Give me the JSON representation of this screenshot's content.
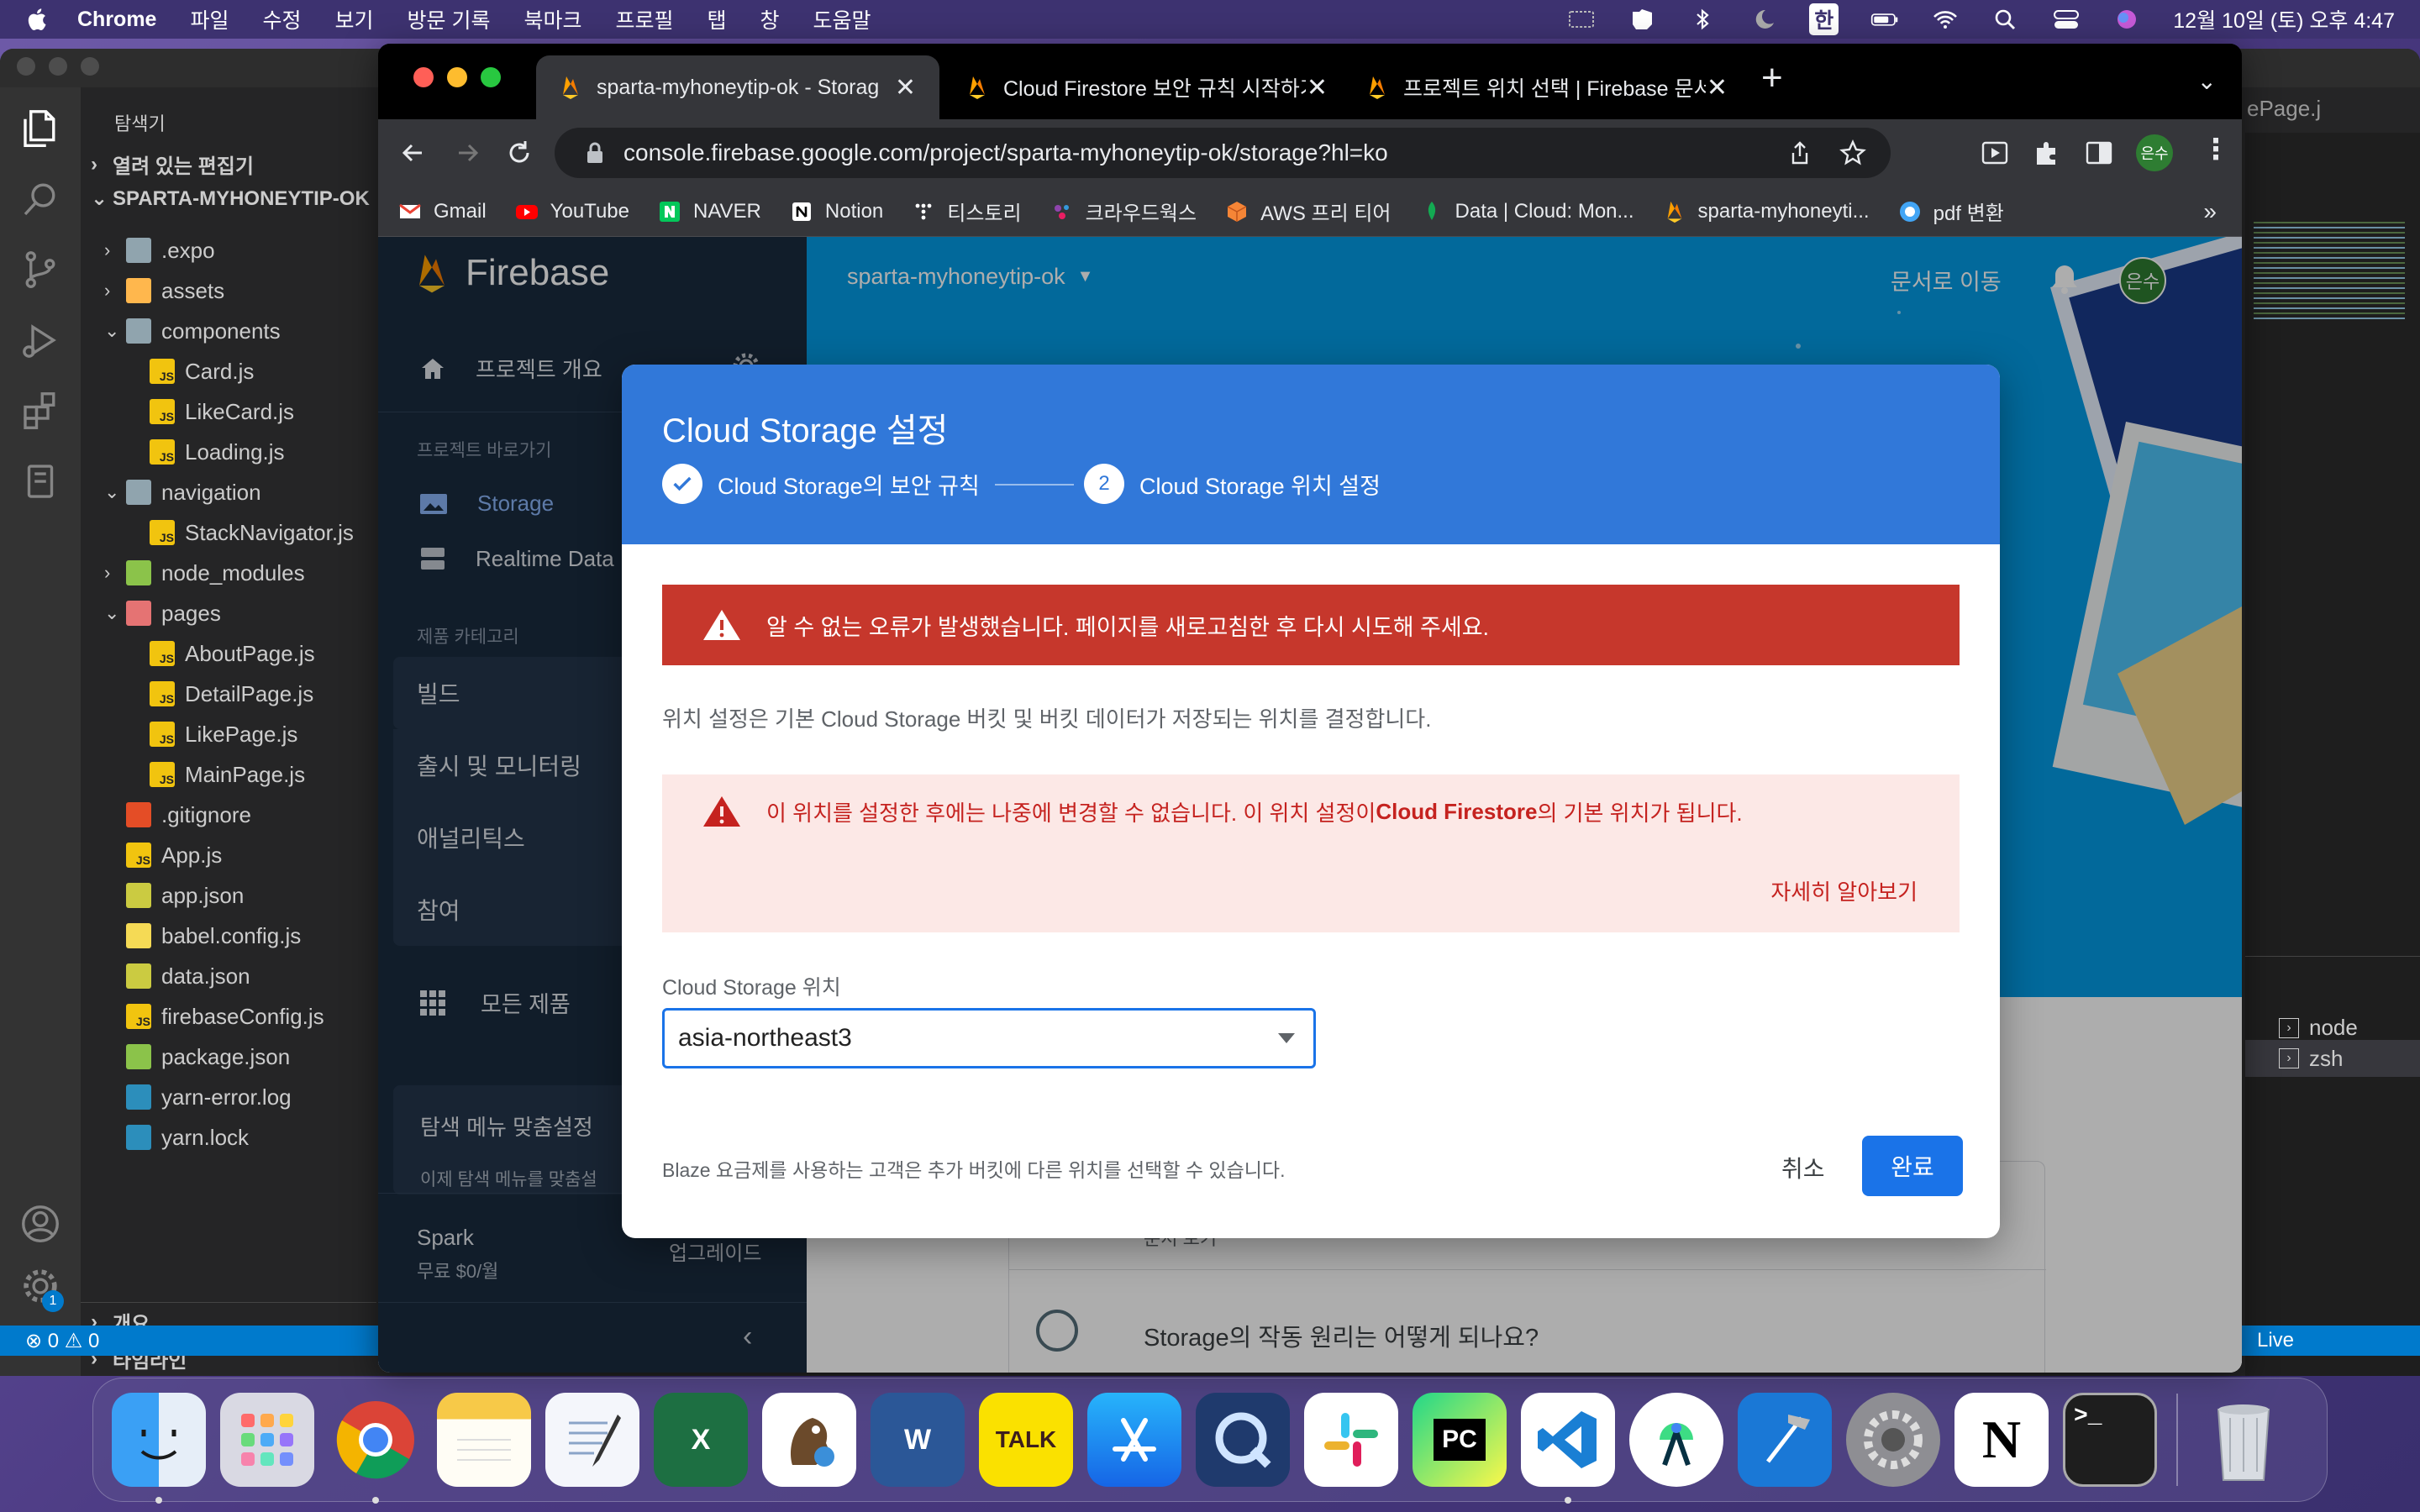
{
  "menubar": {
    "app": "Chrome",
    "items": [
      "파일",
      "수정",
      "보기",
      "방문 기록",
      "북마크",
      "프로필",
      "탭",
      "창",
      "도움말"
    ],
    "ime": "한",
    "datetime": "12월 10일 (토) 오후 4:47"
  },
  "vscode": {
    "explorer_title": "탐색기",
    "open_editors": "열려 있는 편집기",
    "project": "SPARTA-MYHONEYTIP-OK",
    "tree": [
      {
        "name": ".expo",
        "type": "folder",
        "depth": 1,
        "open": false
      },
      {
        "name": "assets",
        "type": "folder",
        "depth": 1,
        "open": false
      },
      {
        "name": "components",
        "type": "folder",
        "depth": 1,
        "open": true
      },
      {
        "name": "Card.js",
        "type": "js",
        "depth": 2
      },
      {
        "name": "LikeCard.js",
        "type": "js",
        "depth": 2
      },
      {
        "name": "Loading.js",
        "type": "js",
        "depth": 2
      },
      {
        "name": "navigation",
        "type": "folder",
        "depth": 1,
        "open": true
      },
      {
        "name": "StackNavigator.js",
        "type": "js",
        "depth": 2
      },
      {
        "name": "node_modules",
        "type": "folder",
        "depth": 1,
        "open": false
      },
      {
        "name": "pages",
        "type": "folder",
        "depth": 1,
        "open": true
      },
      {
        "name": "AboutPage.js",
        "type": "js",
        "depth": 2
      },
      {
        "name": "DetailPage.js",
        "type": "js",
        "depth": 2
      },
      {
        "name": "LikePage.js",
        "type": "js",
        "depth": 2
      },
      {
        "name": "MainPage.js",
        "type": "js",
        "depth": 2
      },
      {
        "name": ".gitignore",
        "type": "git",
        "depth": 1
      },
      {
        "name": "App.js",
        "type": "js",
        "depth": 1
      },
      {
        "name": "app.json",
        "type": "json",
        "depth": 1
      },
      {
        "name": "babel.config.js",
        "type": "babel",
        "depth": 1
      },
      {
        "name": "data.json",
        "type": "json",
        "depth": 1
      },
      {
        "name": "firebaseConfig.js",
        "type": "js",
        "depth": 1
      },
      {
        "name": "package.json",
        "type": "pkg",
        "depth": 1
      },
      {
        "name": "yarn-error.log",
        "type": "yarn",
        "depth": 1
      },
      {
        "name": "yarn.lock",
        "type": "yarn",
        "depth": 1
      }
    ],
    "outline": "개요",
    "timeline": "타임라인",
    "status_left": "⊗ 0 ⚠ 0",
    "status_right": "Live",
    "editor_tab_fragment": "ePage.j",
    "terminals": [
      "node",
      "zsh"
    ],
    "settings_badge": "1"
  },
  "chrome": {
    "tabs": [
      {
        "title": "sparta-myhoneytip-ok - Storag",
        "active": true
      },
      {
        "title": "Cloud Firestore 보안 규칙 시작하기",
        "active": false
      },
      {
        "title": "프로젝트 위치 선택 | Firebase 문서",
        "active": false
      }
    ],
    "new_tab": "+",
    "url": "console.firebase.google.com/project/sparta-myhoneytip-ok/storage?hl=ko",
    "profile": "은수",
    "bookmarks": [
      "Gmail",
      "YouTube",
      "NAVER",
      "Notion",
      "티스토리",
      "크라우드웍스",
      "AWS 프리 티어",
      "Data | Cloud: Mon...",
      "sparta-myhoneyti...",
      "pdf 변환"
    ],
    "more": "»"
  },
  "firebase": {
    "brand": "Firebase",
    "overview": "프로젝트 개요",
    "shortcuts": "프로젝트 바로가기",
    "nav_storage": "Storage",
    "nav_rtdb": "Realtime Data",
    "categories": "제품 카테고리",
    "sections": [
      "빌드",
      "출시 및 모니터링",
      "애널리틱스",
      "참여"
    ],
    "all_products": "모든 제품",
    "customize": "탐색 메뉴 맞춤설정",
    "customize_sub": "이제 탐색 메뉴를 맞춤설",
    "plan": "Spark",
    "plan_price": "무료 $0/월",
    "upgrade": "업그레이드",
    "project_name": "sparta-myhoneytip-ok",
    "docs_link": "문서로 이동",
    "avatar": "은수",
    "card_link": "문서 보기",
    "card_question": "Storage의 작동 원리는 어떻게 되나요?"
  },
  "dialog": {
    "title": "Cloud Storage 설정",
    "step1": "Cloud Storage의 보안 규칙",
    "step2_num": "2",
    "step2": "Cloud Storage 위치 설정",
    "error": "알 수 없는 오류가 발생했습니다. 페이지를 새로고침한 후 다시 시도해 주세요.",
    "description": "위치 설정은 기본 Cloud Storage 버킷 및 버킷 데이터가 저장되는 위치를 결정합니다.",
    "warning_pre": "이 위치를 설정한 후에는 나중에 변경할 수 없습니다. 이 위치 설정이 ",
    "warning_bold": "Cloud Firestore",
    "warning_post": "의 기본 위치가 됩니다.",
    "learn_more": "자세히 알아보기",
    "location_label": "Cloud Storage 위치",
    "location_value": "asia-northeast3",
    "note": "Blaze 요금제를 사용하는 고객은 추가 버킷에 다른 위치를 선택할 수 있습니다.",
    "cancel": "취소",
    "done": "완료"
  },
  "dock": [
    "Finder",
    "Launchpad",
    "Chrome",
    "Notes",
    "TextEdit",
    "Excel",
    "DBeaver",
    "Word",
    "KakaoTalk",
    "App Store",
    "QuickTime",
    "Slack",
    "PyCharm",
    "VS Code",
    "Android Studio",
    "Xcode",
    "System Preferences",
    "Notion",
    "Terminal",
    "Trash"
  ],
  "dock_labels": {
    "kakao": "TALK",
    "pycharm": "PC",
    "word": "W",
    "excel": "X",
    "notion": "N",
    "terminal": ">_"
  }
}
